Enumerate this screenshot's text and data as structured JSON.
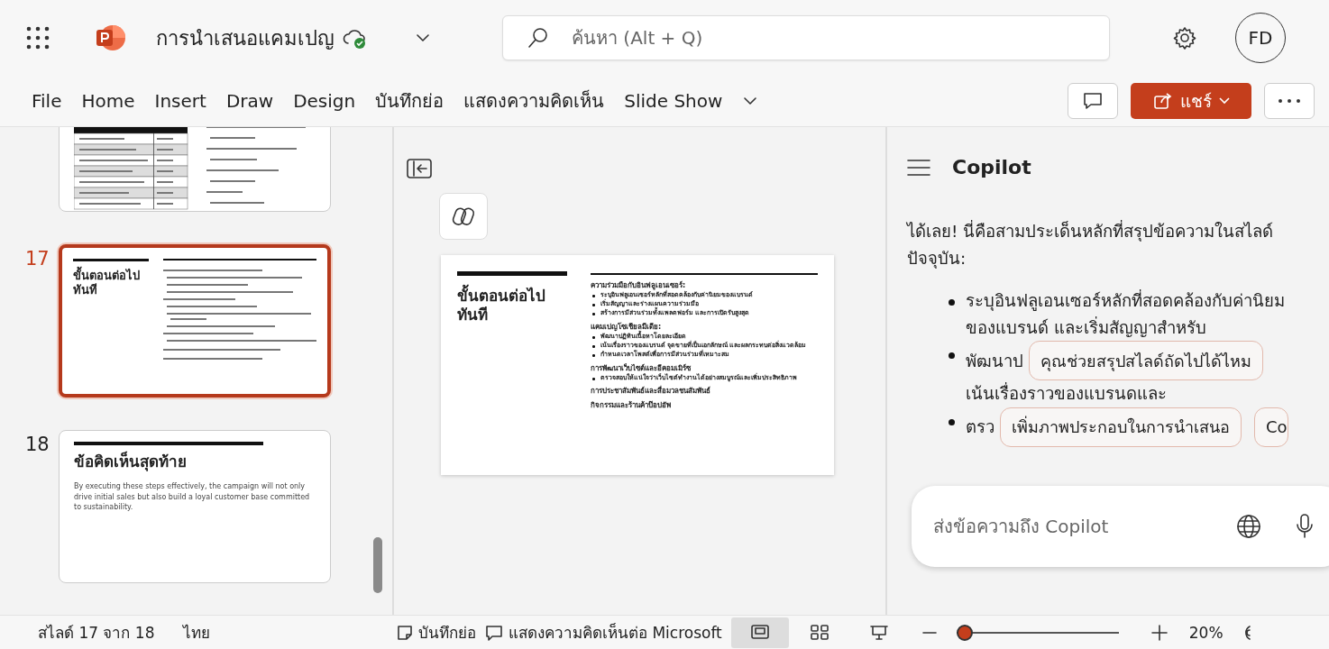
{
  "app": {
    "title": "การนำเสนอแคมเปญ",
    "synced": true
  },
  "search": {
    "placeholder": "ค้นหา (Alt + Q)"
  },
  "user": {
    "initials": "FD"
  },
  "ribbon_tabs": [
    "File",
    "Home",
    "Insert",
    "Draw",
    "Design",
    "บันทึกย่อ",
    "แสดงความคิดเห็น",
    "Slide Show"
  ],
  "share": {
    "label": "แชร์"
  },
  "slides": [
    {
      "kind": "budget",
      "selected": false
    },
    {
      "kind": "steps",
      "number": "17",
      "title": "ขั้นตอนต่อไป ทันที",
      "selected": true
    },
    {
      "kind": "closing",
      "number": "18",
      "title": "ข้อคิดเห็นสุดท้าย",
      "body": "By executing these steps effectively, the campaign will not only drive initial sales but also build a loyal customer base committed to sustainability.",
      "selected": false
    }
  ],
  "current_slide": {
    "title": "ขั้นตอนต่อไป ทันที",
    "sections": [
      {
        "heading": "ความร่วมมือกับอินฟลูเอนเซอร์:",
        "bullets": [
          "ระบุอินฟลูเอนเซอร์หลักที่สอดคล้องกับค่านิยมของแบรนด์",
          "เริ่มสัญญาและร่างแผนความร่วมมือ",
          "สร้างการมีส่วนร่วมทั้งแพลตฟอร์ม และการเปิดรับสูงสุด"
        ]
      },
      {
        "heading": "แคมเปญโซเชียลมีเดีย:",
        "bullets": [
          "พัฒนาปฏิทินเนื้อหาโดยละเอียด",
          "เน้นเรื่องราวของแบรนด์ จุดขายที่เป็นเอกลักษณ์ และผลกระทบต่อสิ่งแวดล้อม",
          "กำหนดเวลาโพสต์เพื่อการมีส่วนร่วมที่เหมาะสม"
        ]
      },
      {
        "heading": "การพัฒนาเว็บไซต์และอีคอมเมิร์ซ",
        "bullets": [
          "ตรวจสอบให้แน่ใจว่าเว็บไซต์ทำงานได้อย่างสมบูรณ์และเพิ่มประสิทธิภาพ"
        ]
      },
      {
        "heading": "การประชาสัมพันธ์และสื่อมวลชนสัมพันธ์"
      },
      {
        "heading": "กิจกรรมและร้านค้าป๊อปอัพ"
      }
    ]
  },
  "copilot": {
    "title": "Copilot",
    "intro": "ได้เลย! นี่คือสามประเด็นหลักที่สรุปข้อความในสไลด์ปัจจุบัน:",
    "bullets": [
      {
        "lines": [
          "ระบุอินฟลูเอนเซอร์หลักที่สอดคล้องกับค่านิยมของแบรนด์ และเริ่มสัญญาสำหรับ"
        ]
      },
      {
        "lines": [
          "พัฒนาป",
          "เน้นเรื่องราวของแบรนดและ"
        ],
        "suggestions": [
          "คุณช่วยสรุปสไลด์ถัดไปได้ไหม"
        ]
      },
      {
        "lines": [
          "ตรว"
        ],
        "suggestions": [
          "เพิ่มภาพประกอบในการนำเสนอ",
          "Co"
        ]
      }
    ],
    "input_placeholder": "ส่งข้อความถึง Copilot"
  },
  "status_bar": {
    "slide_position": "สไลด์ 17 จาก 18",
    "language": "ไทย",
    "notes": "บันทึกย่อ",
    "feedback": "แสดงความคิดเห็นต่อ Microsoft",
    "views": [
      {
        "kind": "normal",
        "selected": true
      },
      {
        "kind": "sorter",
        "selected": false
      },
      {
        "kind": "reading",
        "selected": false
      }
    ],
    "zoom": {
      "level": 0.05,
      "reading": "20%"
    }
  }
}
